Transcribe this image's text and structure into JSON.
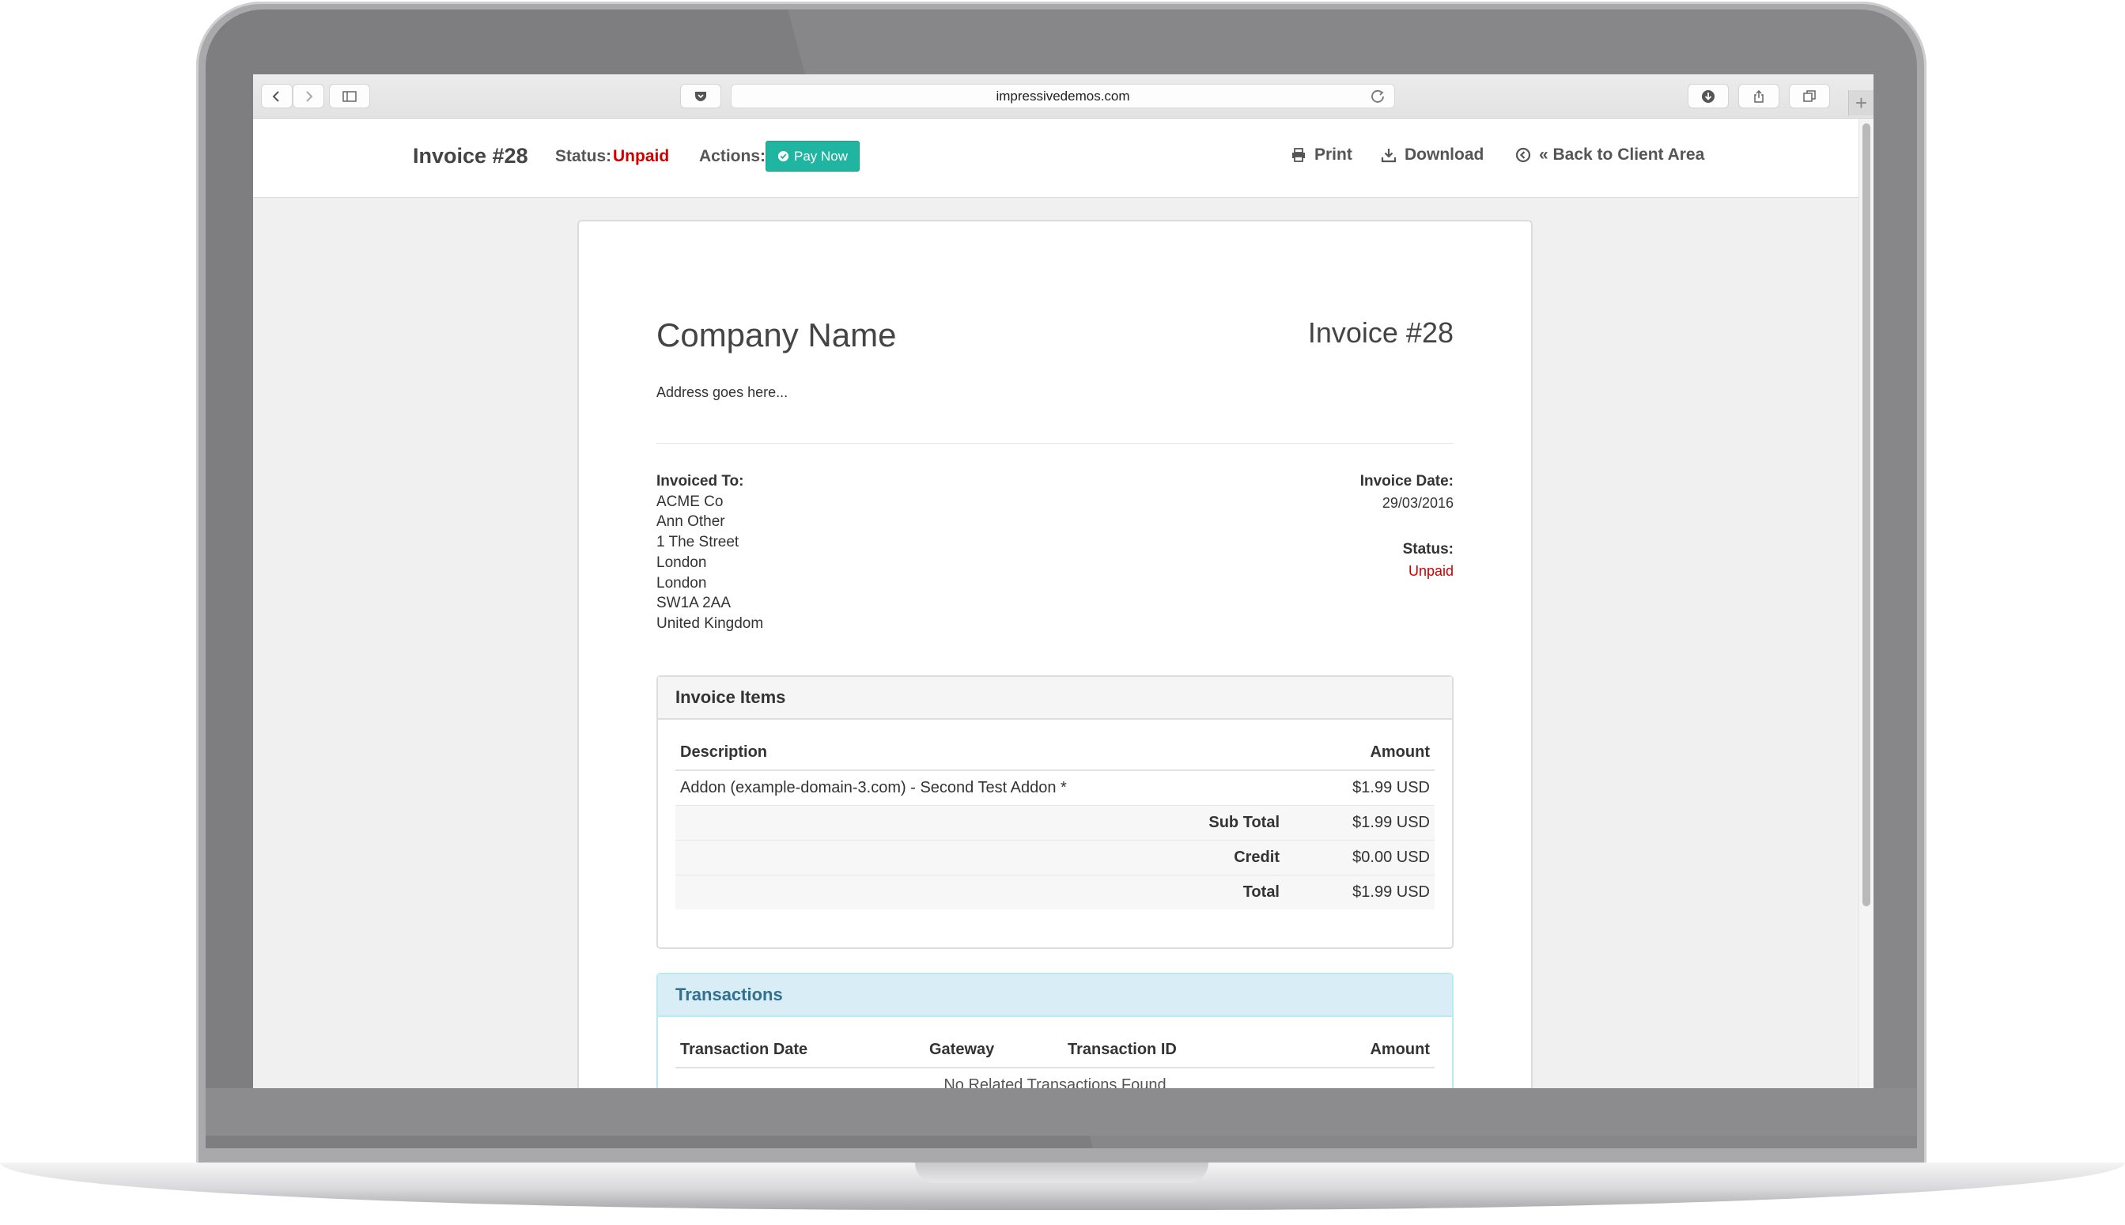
{
  "browser": {
    "url": "impressivedemos.com"
  },
  "header": {
    "title": "Invoice #28",
    "status_label": "Status:",
    "status_value": "Unpaid",
    "actions_label": "Actions:",
    "pay_now": "Pay Now",
    "print": "Print",
    "download": "Download",
    "back": "« Back to Client Area"
  },
  "invoice": {
    "company_name": "Company Name",
    "invoice_number": "Invoice #28",
    "address": "Address goes here...",
    "invoiced_to_label": "Invoiced To:",
    "invoiced_to_lines": [
      "ACME Co",
      "Ann Other",
      "1 The Street",
      "London",
      "London",
      "SW1A 2AA",
      "United Kingdom"
    ],
    "invoice_date_label": "Invoice Date:",
    "invoice_date": "29/03/2016",
    "status_label": "Status:",
    "status_value": "Unpaid"
  },
  "items_panel": {
    "title": "Invoice Items",
    "columns": [
      "Description",
      "Amount"
    ],
    "rows": [
      {
        "description": "Addon (example-domain-3.com) - Second Test Addon *",
        "amount": "$1.99 USD"
      }
    ],
    "summary": [
      {
        "label": "Sub Total",
        "amount": "$1.99 USD"
      },
      {
        "label": "Credit",
        "amount": "$0.00 USD"
      },
      {
        "label": "Total",
        "amount": "$1.99 USD"
      }
    ]
  },
  "transactions_panel": {
    "title": "Transactions",
    "columns": [
      "Transaction Date",
      "Gateway",
      "Transaction ID",
      "Amount"
    ],
    "empty_message": "No Related Transactions Found"
  },
  "colors": {
    "accent_pay": "#1fb5a0",
    "status_unpaid": "#cc0000",
    "info_panel": "#d9edf7"
  },
  "icons": {
    "back": "chevron-left-icon",
    "forward": "chevron-right-icon",
    "sidebar": "sidebar-icon",
    "shield": "shield-icon",
    "reload": "reload-icon",
    "downloads": "download-circle-icon",
    "share": "share-icon",
    "tabs": "tabs-icon",
    "print": "print-icon",
    "download": "download-icon",
    "back_client": "arrow-circle-left-icon",
    "pay": "check-circle-icon"
  }
}
